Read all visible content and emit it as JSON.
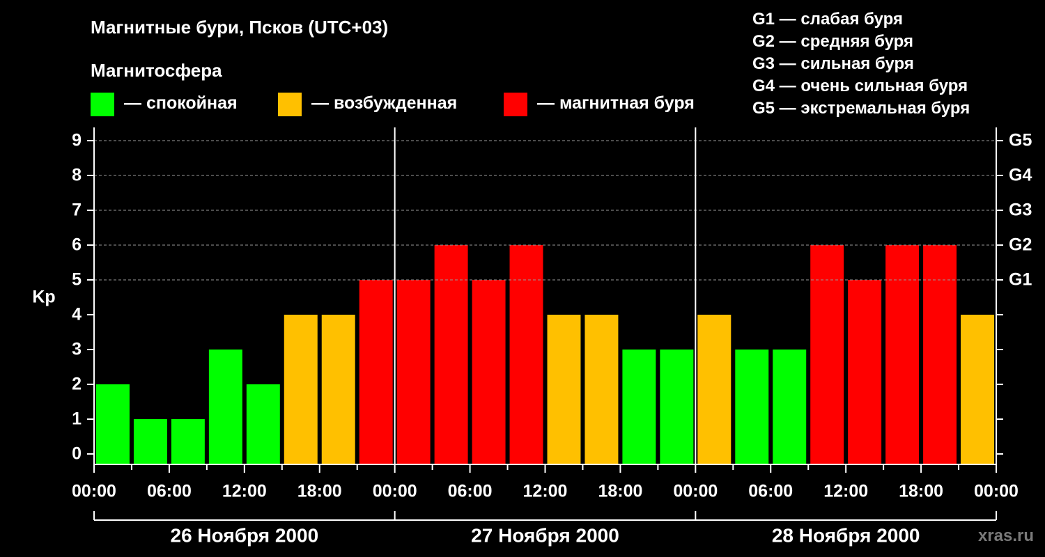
{
  "header": {
    "title": "Магнитные бури, Псков (UTC+03)",
    "legend_title": "Магнитосфера"
  },
  "legend": [
    {
      "label": "— спокойная",
      "color": "#00ff00"
    },
    {
      "label": "— возбужденная",
      "color": "#ffc000"
    },
    {
      "label": "— магнитная буря",
      "color": "#ff0000"
    }
  ],
  "g_legend": [
    "G1 — слабая буря",
    "G2 — средняя буря",
    "G3 — сильная буря",
    "G4 — очень сильная буря",
    "G5 — экстремальная буря"
  ],
  "watermark": "xras.ru",
  "chart_data": {
    "type": "bar",
    "ylabel": "Kp",
    "ylim": [
      0,
      9
    ],
    "yticks": [
      "0",
      "1",
      "2",
      "3",
      "4",
      "5",
      "6",
      "7",
      "8",
      "9"
    ],
    "right_ticks": [
      {
        "value": 5,
        "label": "G1"
      },
      {
        "value": 6,
        "label": "G2"
      },
      {
        "value": 7,
        "label": "G3"
      },
      {
        "value": 8,
        "label": "G4"
      },
      {
        "value": 9,
        "label": "G5"
      }
    ],
    "xticks": [
      "00:00",
      "06:00",
      "12:00",
      "18:00",
      "00:00",
      "06:00",
      "12:00",
      "18:00",
      "00:00",
      "06:00",
      "12:00",
      "18:00",
      "00:00"
    ],
    "days": [
      "26 Ноября 2000",
      "27 Ноября 2000",
      "28 Ноября 2000"
    ],
    "values": [
      2,
      1,
      1,
      3,
      2,
      4,
      4,
      5,
      5,
      6,
      5,
      6,
      4,
      4,
      3,
      3,
      4,
      3,
      3,
      6,
      5,
      6,
      6,
      4
    ],
    "colors": {
      "quiet": "#00ff00",
      "active": "#ffc000",
      "storm": "#ff0000"
    },
    "grid": "dashed at Kp 5–9"
  }
}
